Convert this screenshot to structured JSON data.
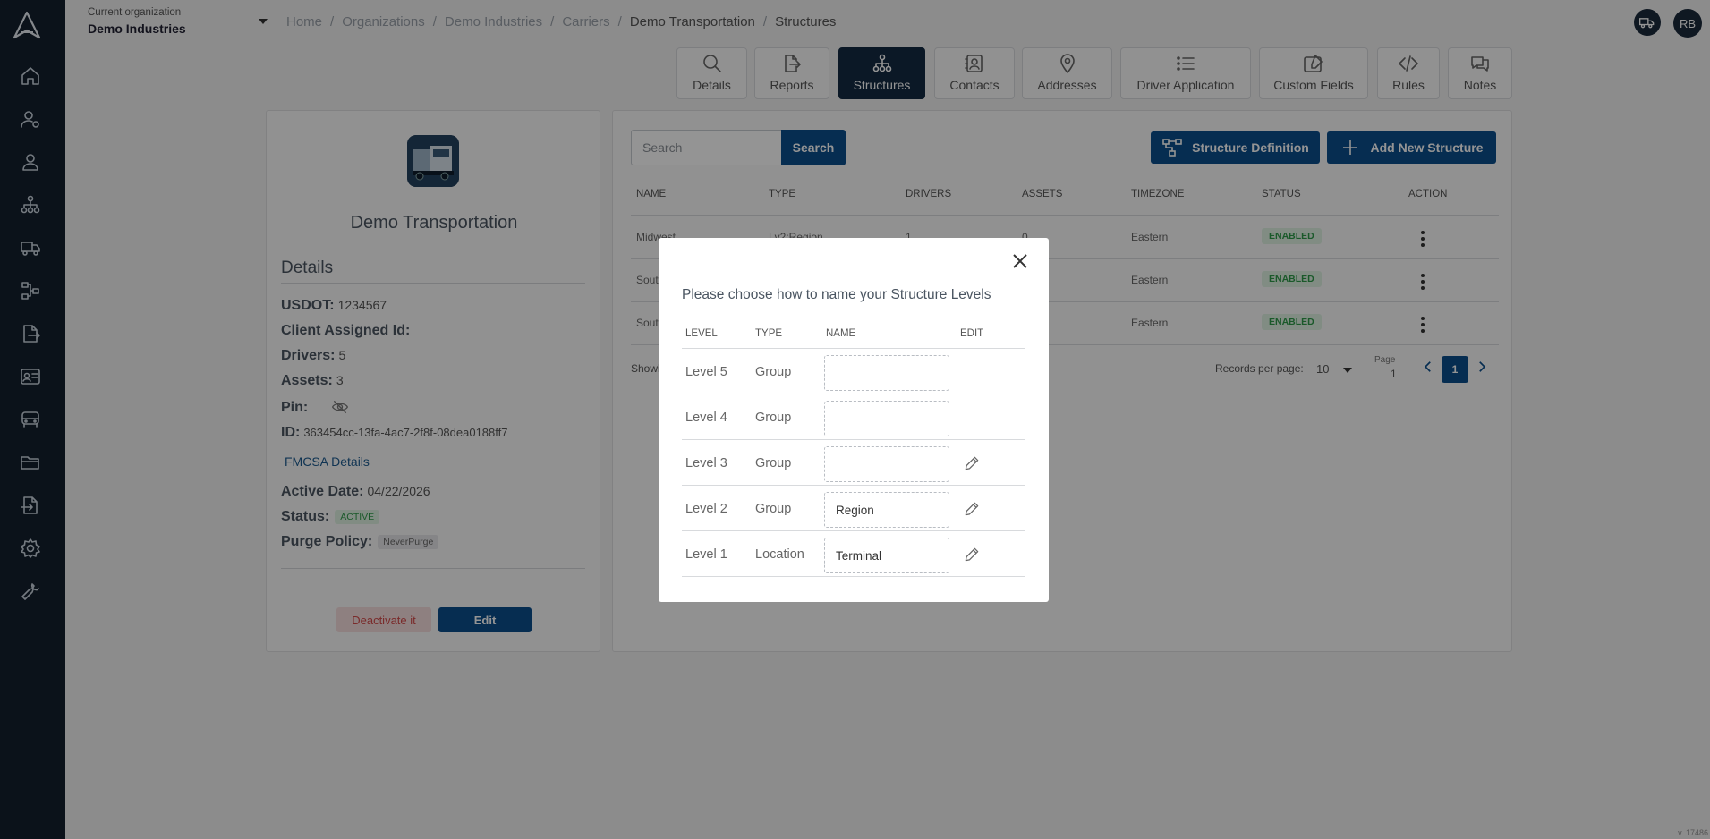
{
  "org": {
    "label": "Current organization",
    "name": "Demo Industries"
  },
  "breadcrumb": [
    "Home",
    "Organizations",
    "Demo Industries",
    "Carriers",
    "Demo Transportation",
    "Structures"
  ],
  "user": {
    "initials": "RB"
  },
  "tabs": [
    {
      "label": "Details",
      "icon": "search-icon"
    },
    {
      "label": "Reports",
      "icon": "export-icon"
    },
    {
      "label": "Structures",
      "icon": "hierarchy-icon",
      "active": true
    },
    {
      "label": "Contacts",
      "icon": "contact-card-icon"
    },
    {
      "label": "Addresses",
      "icon": "map-pin-icon"
    },
    {
      "label": "Driver Application",
      "icon": "list-icon"
    },
    {
      "label": "Custom Fields",
      "icon": "edit-form-icon"
    },
    {
      "label": "Rules",
      "icon": "code-icon"
    },
    {
      "label": "Notes",
      "icon": "chat-icon"
    }
  ],
  "carrier": {
    "name": "Demo Transportation",
    "details_title": "Details",
    "usdot_label": "USDOT:",
    "usdot": "1234567",
    "client_id_label": "Client Assigned Id:",
    "drivers_label": "Drivers:",
    "drivers": "5",
    "assets_label": "Assets:",
    "assets": "3",
    "pin_label": "Pin:",
    "id_label": "ID:",
    "id": "363454cc-13fa-4ac7-2f8f-08dea0188ff7",
    "fmcsa_link": "FMCSA Details",
    "active_date_label": "Active Date:",
    "active_date": "04/22/2026",
    "status_label": "Status:",
    "status": "ACTIVE",
    "purge_label": "Purge Policy:",
    "purge": "NeverPurge",
    "deactivate_label": "Deactivate it",
    "edit_label": "Edit"
  },
  "structures": {
    "search_placeholder": "Search",
    "search_label": "Search",
    "definition_label": "Structure Definition",
    "add_label": "Add New Structure",
    "columns": [
      "NAME",
      "TYPE",
      "DRIVERS",
      "ASSETS",
      "TIMEZONE",
      "STATUS",
      "ACTION"
    ],
    "rows": [
      {
        "name": "Midwest",
        "type": "Lv2:Region",
        "drivers": "1",
        "assets": "0",
        "timezone": "Eastern",
        "status": "ENABLED"
      },
      {
        "name": "Sout",
        "type": "",
        "drivers": "",
        "assets": "",
        "timezone": "Eastern",
        "status": "ENABLED"
      },
      {
        "name": "Sout",
        "type": "",
        "drivers": "",
        "assets": "",
        "timezone": "Eastern",
        "status": "ENABLED"
      }
    ],
    "showing": "Showi",
    "records_label": "Records per page:",
    "records_value": "10",
    "page_label": "Page",
    "page_value": "1",
    "current_page": "1"
  },
  "modal": {
    "title": "Please choose how to name your Structure Levels",
    "columns": [
      "LEVEL",
      "TYPE",
      "NAME",
      "EDIT"
    ],
    "rows": [
      {
        "level": "Level 5",
        "type": "Group",
        "name": "",
        "editable": false
      },
      {
        "level": "Level 4",
        "type": "Group",
        "name": "",
        "editable": false
      },
      {
        "level": "Level 3",
        "type": "Group",
        "name": "",
        "editable": true
      },
      {
        "level": "Level 2",
        "type": "Group",
        "name": "Region",
        "editable": true
      },
      {
        "level": "Level 1",
        "type": "Location",
        "name": "Terminal",
        "editable": true
      }
    ]
  },
  "version": "v. 17486"
}
